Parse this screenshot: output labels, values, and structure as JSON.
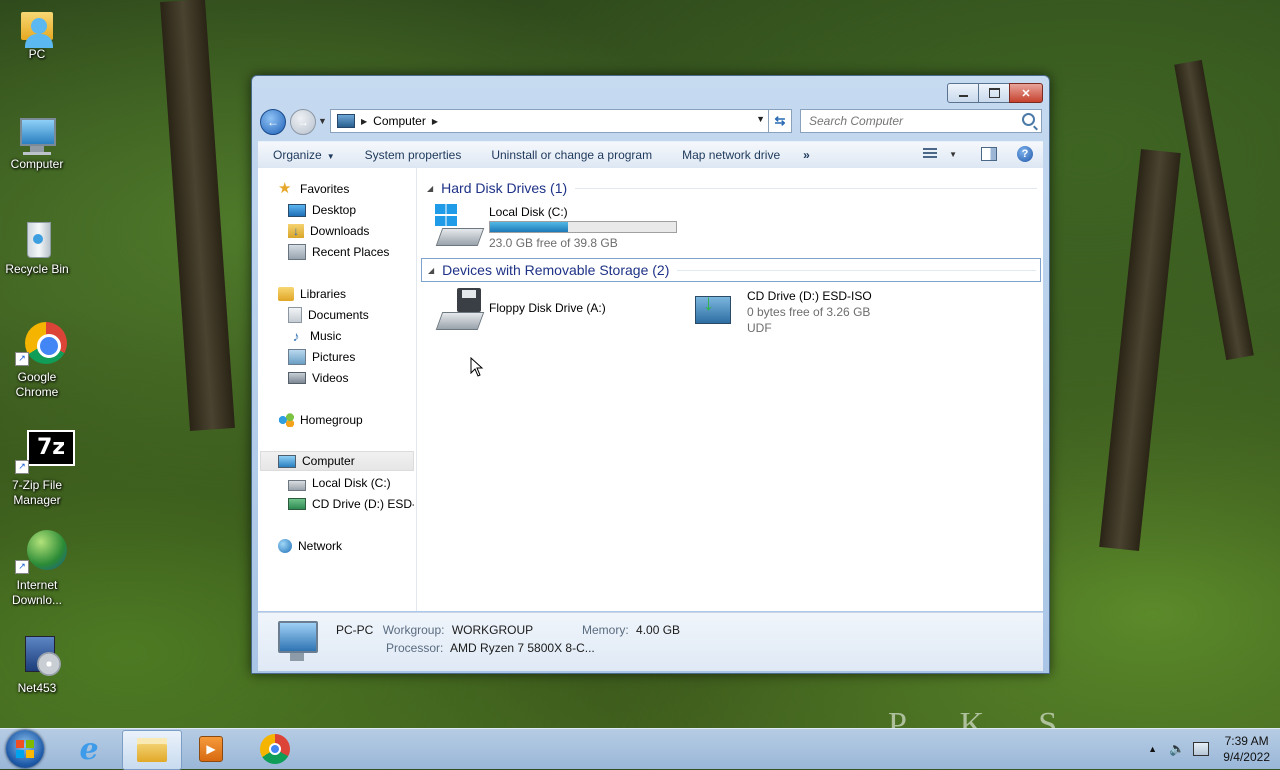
{
  "desktop": {
    "icons": [
      {
        "label": "PC"
      },
      {
        "label": "Computer"
      },
      {
        "label": "Recycle Bin"
      },
      {
        "label": "Google Chrome"
      },
      {
        "label": "7-Zip File Manager"
      },
      {
        "label": "Internet Downlo..."
      },
      {
        "label": "Net453"
      }
    ],
    "watermark": "P    K    S"
  },
  "window": {
    "address": {
      "location": "Computer"
    },
    "search": {
      "placeholder": "Search Computer"
    },
    "toolbar": {
      "organize": "Organize",
      "system_properties": "System properties",
      "uninstall": "Uninstall or change a program",
      "map_drive": "Map network drive",
      "more": "»"
    },
    "nav": {
      "favorites": "Favorites",
      "desktop": "Desktop",
      "downloads": "Downloads",
      "recent_places": "Recent Places",
      "libraries": "Libraries",
      "documents": "Documents",
      "music": "Music",
      "pictures": "Pictures",
      "videos": "Videos",
      "homegroup": "Homegroup",
      "computer": "Computer",
      "local_disk": "Local Disk (C:)",
      "cd_drive": "CD Drive (D:) ESD-IS",
      "network": "Network"
    },
    "groups": {
      "hard_disks": "Hard Disk Drives (1)",
      "removable": "Devices with Removable Storage (2)"
    },
    "drives": {
      "c": {
        "name": "Local Disk (C:)",
        "free_text": "23.0 GB free of 39.8 GB",
        "used_fraction": 0.42
      },
      "floppy": {
        "name": "Floppy Disk Drive (A:)"
      },
      "cd": {
        "name": "CD Drive (D:) ESD-ISO",
        "free_text": "0 bytes free of 3.26 GB",
        "fs": "UDF"
      }
    },
    "details": {
      "pc_name": "PC-PC",
      "workgroup_label": "Workgroup:",
      "workgroup": "WORKGROUP",
      "memory_label": "Memory:",
      "memory": "4.00 GB",
      "processor_label": "Processor:",
      "processor": "AMD Ryzen 7 5800X 8-C..."
    }
  },
  "taskbar": {
    "clock_time": "7:39 AM",
    "clock_date": "9/4/2022"
  },
  "colors": {
    "accent": "#1e3287",
    "progress": "#1d78b7"
  }
}
